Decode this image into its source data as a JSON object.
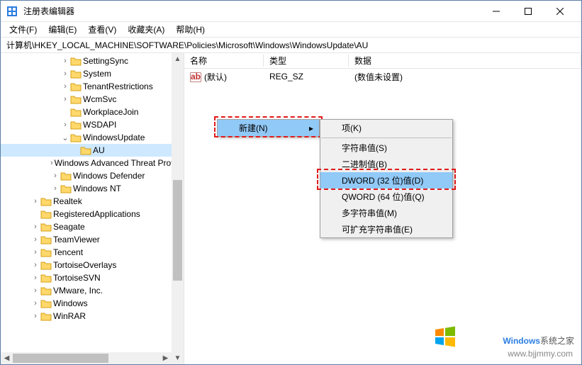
{
  "window": {
    "title": "注册表编辑器"
  },
  "menu": {
    "file": "文件(F)",
    "edit": "编辑(E)",
    "view": "查看(V)",
    "favorites": "收藏夹(A)",
    "help": "帮助(H)"
  },
  "address": "计算机\\HKEY_LOCAL_MACHINE\\SOFTWARE\\Policies\\Microsoft\\Windows\\WindowsUpdate\\AU",
  "tree": [
    {
      "indent": 6,
      "expander": "›",
      "label": "SettingSync"
    },
    {
      "indent": 6,
      "expander": "›",
      "label": "System"
    },
    {
      "indent": 6,
      "expander": "›",
      "label": "TenantRestrictions"
    },
    {
      "indent": 6,
      "expander": "›",
      "label": "WcmSvc"
    },
    {
      "indent": 6,
      "expander": "",
      "label": "WorkplaceJoin"
    },
    {
      "indent": 6,
      "expander": "›",
      "label": "WSDAPI"
    },
    {
      "indent": 6,
      "expander": "⌄",
      "label": "WindowsUpdate"
    },
    {
      "indent": 7,
      "expander": "",
      "label": "AU",
      "selected": true
    },
    {
      "indent": 5,
      "expander": "›",
      "label": "Windows Advanced Threat Protection"
    },
    {
      "indent": 5,
      "expander": "›",
      "label": "Windows Defender"
    },
    {
      "indent": 5,
      "expander": "›",
      "label": "Windows NT"
    },
    {
      "indent": 3,
      "expander": "›",
      "label": "Realtek"
    },
    {
      "indent": 3,
      "expander": "",
      "label": "RegisteredApplications"
    },
    {
      "indent": 3,
      "expander": "›",
      "label": "Seagate"
    },
    {
      "indent": 3,
      "expander": "›",
      "label": "TeamViewer"
    },
    {
      "indent": 3,
      "expander": "›",
      "label": "Tencent"
    },
    {
      "indent": 3,
      "expander": "›",
      "label": "TortoiseOverlays"
    },
    {
      "indent": 3,
      "expander": "›",
      "label": "TortoiseSVN"
    },
    {
      "indent": 3,
      "expander": "›",
      "label": "VMware, Inc."
    },
    {
      "indent": 3,
      "expander": "›",
      "label": "Windows"
    },
    {
      "indent": 3,
      "expander": "›",
      "label": "WinRAR"
    }
  ],
  "list": {
    "headers": {
      "name": "名称",
      "type": "类型",
      "data": "数据"
    },
    "rows": [
      {
        "name": "(默认)",
        "type": "REG_SZ",
        "data": "(数值未设置)"
      }
    ]
  },
  "context_primary": {
    "new": "新建(N)"
  },
  "context_submenu": {
    "key": "项(K)",
    "string": "字符串值(S)",
    "binary": "二进制值(B)",
    "dword": "DWORD (32 位)值(D)",
    "qword": "QWORD (64 位)值(Q)",
    "multistring": "多字符串值(M)",
    "expandstring": "可扩充字符串值(E)"
  },
  "watermark": {
    "brand_prefix": "Windows",
    "brand_suffix": "系统之家",
    "url": "www.bjjmmy.com"
  }
}
